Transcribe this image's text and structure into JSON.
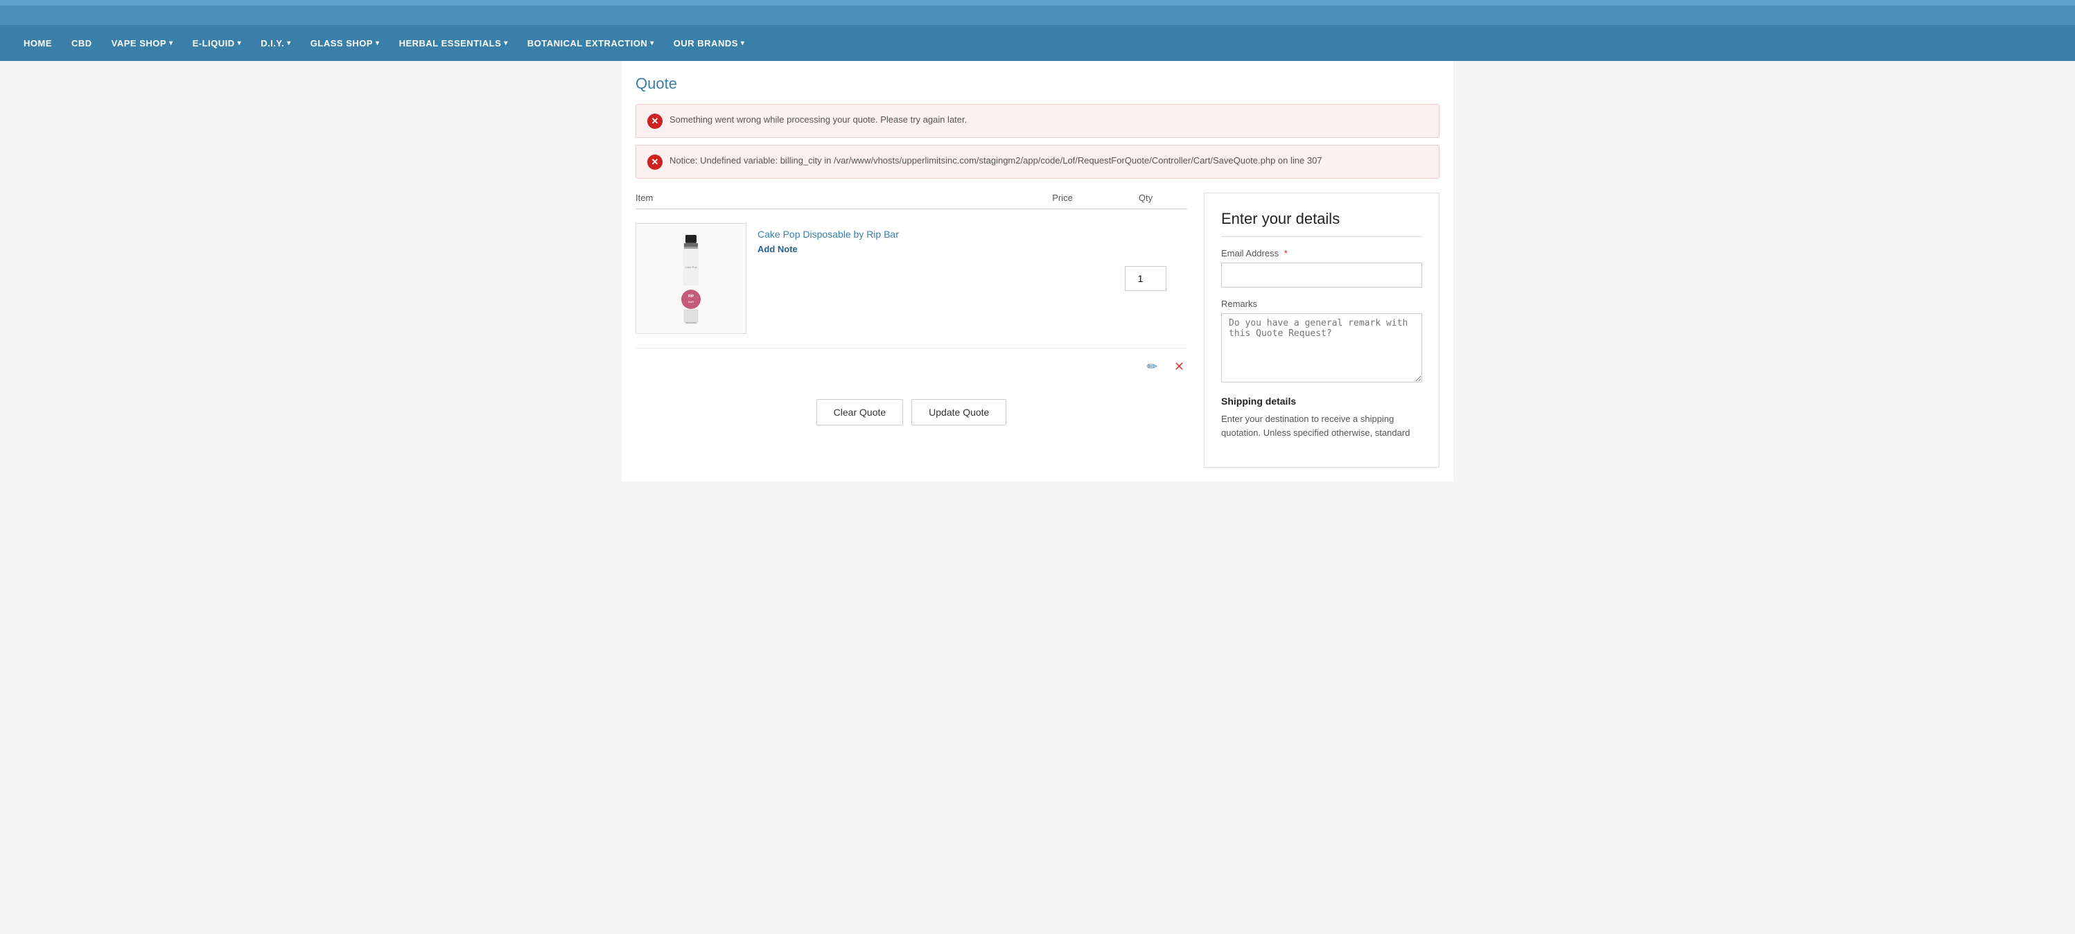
{
  "top_bar": {
    "color": "#4a90b8"
  },
  "nav": {
    "items": [
      {
        "label": "HOME",
        "has_dropdown": false
      },
      {
        "label": "CBD",
        "has_dropdown": false
      },
      {
        "label": "VAPE SHOP",
        "has_dropdown": true
      },
      {
        "label": "E-LIQUID",
        "has_dropdown": true
      },
      {
        "label": "D.I.Y.",
        "has_dropdown": true
      },
      {
        "label": "GLASS SHOP",
        "has_dropdown": true
      },
      {
        "label": "HERBAL ESSENTIALS",
        "has_dropdown": true
      },
      {
        "label": "BOTANICAL EXTRACTION",
        "has_dropdown": true
      },
      {
        "label": "OUR BRANDS",
        "has_dropdown": true
      }
    ]
  },
  "page": {
    "title": "Quote"
  },
  "errors": [
    {
      "id": "err1",
      "text": "Something went wrong while processing your quote. Please try again later."
    },
    {
      "id": "err2",
      "text": "Notice: Undefined variable: billing_city in /var/www/vhosts/upperlimitsinc.com/stagingm2/app/code/Lof/RequestForQuote/Controller/Cart/SaveQuote.php on line 307"
    }
  ],
  "table": {
    "col_item": "Item",
    "col_price": "Price",
    "col_qty": "Qty"
  },
  "product": {
    "name": "Cake Pop Disposable by Rip Bar",
    "add_note_label": "Add Note",
    "price": "",
    "qty": "1"
  },
  "actions": {
    "edit_icon": "✏",
    "remove_icon": "✕"
  },
  "buttons": {
    "clear_quote": "Clear Quote",
    "update_quote": "Update Quote"
  },
  "details_panel": {
    "title": "Enter your details",
    "email_label": "Email Address",
    "email_required": true,
    "email_placeholder": "",
    "remarks_label": "Remarks",
    "remarks_placeholder": "Do you have a general remark with this Quote Request?",
    "shipping_title": "Shipping details",
    "shipping_desc": "Enter your destination to receive a shipping quotation. Unless specified otherwise, standard"
  }
}
